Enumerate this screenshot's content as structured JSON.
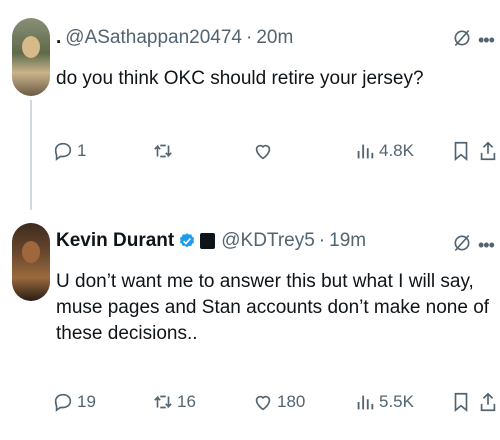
{
  "tweets": [
    {
      "display_name": "",
      "handle": "@ASathappan20474",
      "time": "20m",
      "text": "do you think OKC should retire your jersey?",
      "replies": "1",
      "retweets": "",
      "likes": "",
      "views": "4.8K"
    },
    {
      "display_name": "Kevin Durant",
      "handle": "@KDTrey5",
      "time": "19m",
      "text": "U don’t want me to answer this but what I will say, muse pages and Stan accounts don’t make none of these decisions..",
      "replies": "19",
      "retweets": "16",
      "likes": "180",
      "views": "5.5K"
    }
  ],
  "separator": "·",
  "first_name_prefix": ".",
  "more_label": "•••",
  "colors": {
    "text": "#0f1419",
    "secondary": "#536471",
    "verified": "#1d9bf0",
    "thread_line": "#cfd9de"
  },
  "icons": [
    "grok-icon",
    "more-icon",
    "reply-icon",
    "retweet-icon",
    "like-icon",
    "views-icon",
    "bookmark-icon",
    "share-icon",
    "verified-badge-icon",
    "affiliate-badge-icon"
  ]
}
